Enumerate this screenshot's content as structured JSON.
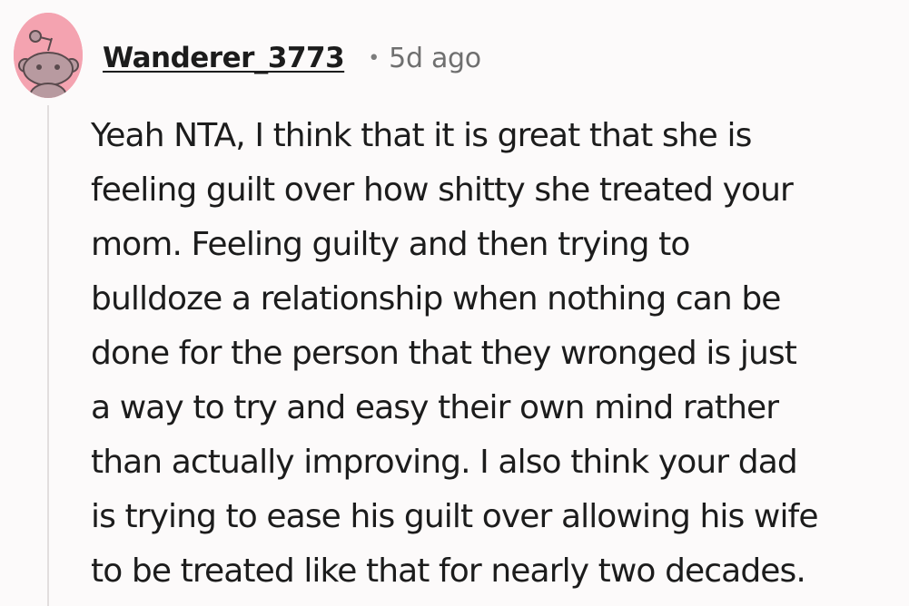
{
  "comment": {
    "author": "Wanderer_3773",
    "separator": "•",
    "timestamp": "5d ago",
    "avatar_icon": "snoo-avatar-icon",
    "avatar_color": "#f4a3b0",
    "body_lines": [
      "Yeah NTA, I think that it is great that she is",
      "feeling guilt over how shitty she treated your",
      "mom. Feeling guilty and then trying to",
      "bulldoze a relationship when nothing can be",
      "done for the person that they wronged is just",
      "a way to try and easy their own mind rather",
      "than actually improving. I also think your dad",
      "is trying to ease his guilt over allowing his wife",
      "to be treated like that for nearly two decades."
    ]
  }
}
